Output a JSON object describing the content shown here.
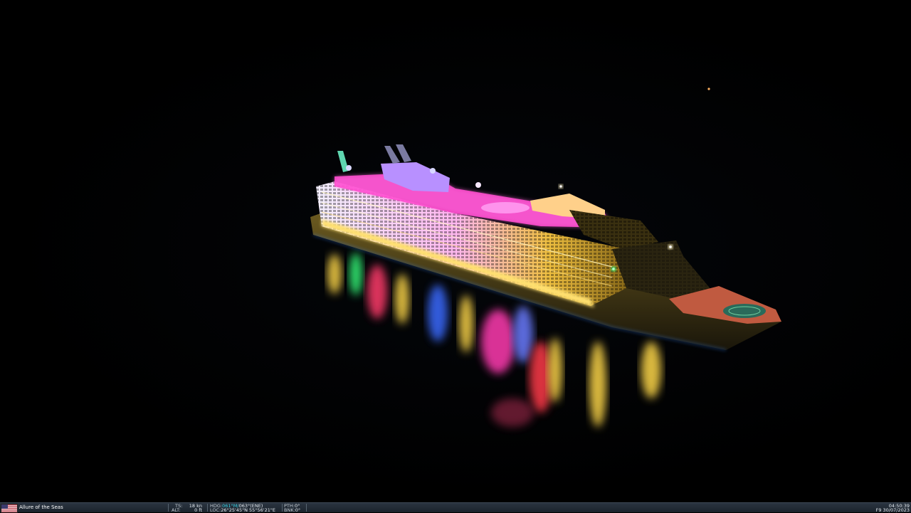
{
  "scene": {
    "name": "night-sea-cruise-ship",
    "accent_colors": [
      "#ff3ab0",
      "#7a5cff",
      "#ffd84a",
      "#35ff7a",
      "#3a6bff",
      "#ff3a4a"
    ]
  },
  "hud": {
    "flag_icon": "us-flag-icon",
    "vessel_name": "Allure of the Seas",
    "ts_label": "TS:",
    "ts_value": "18 kn",
    "alt_label": "ALT:",
    "alt_value": "0 ft",
    "hdg_label": "HDG:",
    "hdg_magnetic": "061°M/",
    "hdg_true": "063°(ENE)",
    "loc_label": "LOC:",
    "loc_value": "26°25'45\"N 55°56'21\"E",
    "pth_label": "PTH:",
    "pth_value": "0°",
    "bnk_label": "BNK:",
    "bnk_value": "0°",
    "time": "04:50:39",
    "date": "F9 30/07/2023"
  }
}
